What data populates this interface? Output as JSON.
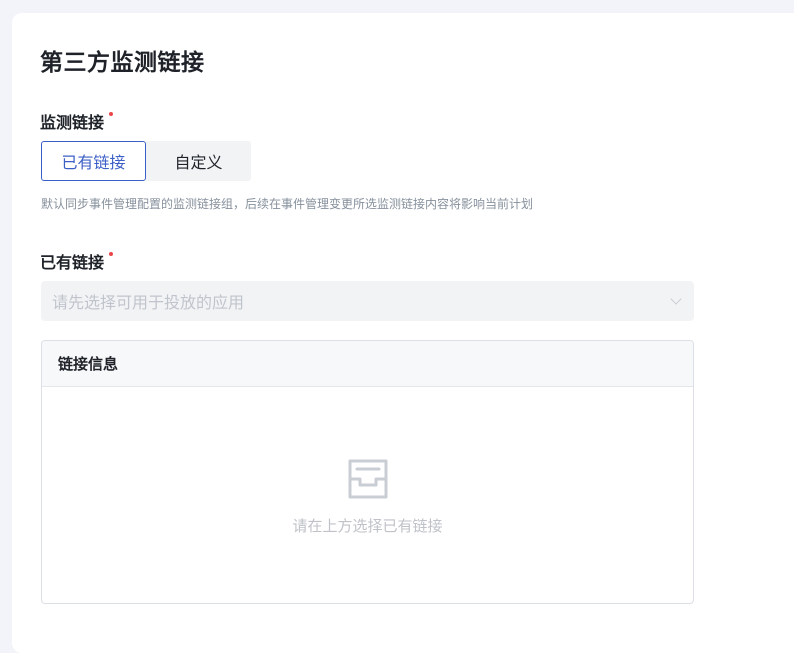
{
  "section": {
    "title": "第三方监测链接"
  },
  "monitor_link": {
    "label": "监测链接",
    "required_color": "#e8484a",
    "options": [
      {
        "label": "已有链接",
        "selected": true
      },
      {
        "label": "自定义",
        "selected": false
      }
    ],
    "hint": "默认同步事件管理配置的监测链接组，后续在事件管理变更所选监测链接内容将影响当前计划"
  },
  "existing_link": {
    "label": "已有链接",
    "select_placeholder": "请先选择可用于投放的应用",
    "select_icon": "chevron-down-icon"
  },
  "link_info_panel": {
    "title": "链接信息",
    "empty_icon": "inbox-icon",
    "empty_text": "请在上方选择已有链接"
  },
  "colors": {
    "accent": "#3b5fc6",
    "required": "#e8484a"
  }
}
